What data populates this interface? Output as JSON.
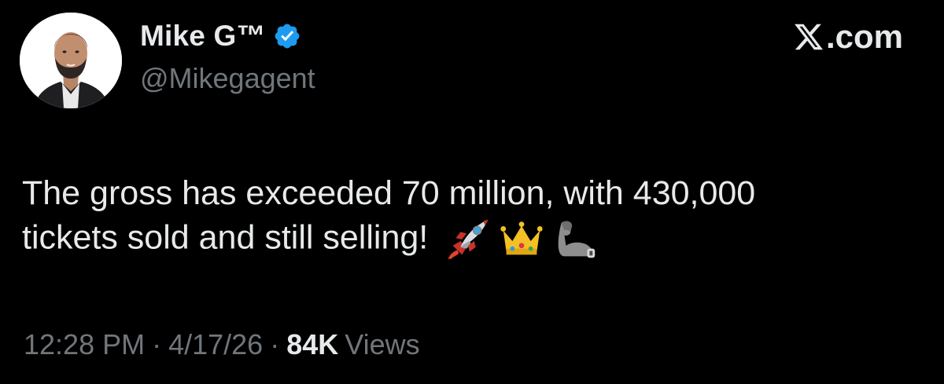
{
  "author": {
    "display_name": "Mike G™",
    "handle": "@Mikegagent",
    "verified": true
  },
  "brand": {
    "label": ".com"
  },
  "tweet": {
    "text_line1": "The gross has exceeded 70 million, with 430,000",
    "text_line2": "tickets sold and still selling!",
    "emojis": [
      "rocket-icon",
      "crown-icon",
      "flexed-biceps-icon"
    ]
  },
  "meta": {
    "time": "12:28 PM",
    "separator": "·",
    "date": "4/17/26",
    "views_count": "84K",
    "views_label": "Views"
  },
  "colors": {
    "background": "#000000",
    "text_primary": "#e7e9ea",
    "text_secondary": "#71767b",
    "verified_blue": "#1d9bf0"
  }
}
